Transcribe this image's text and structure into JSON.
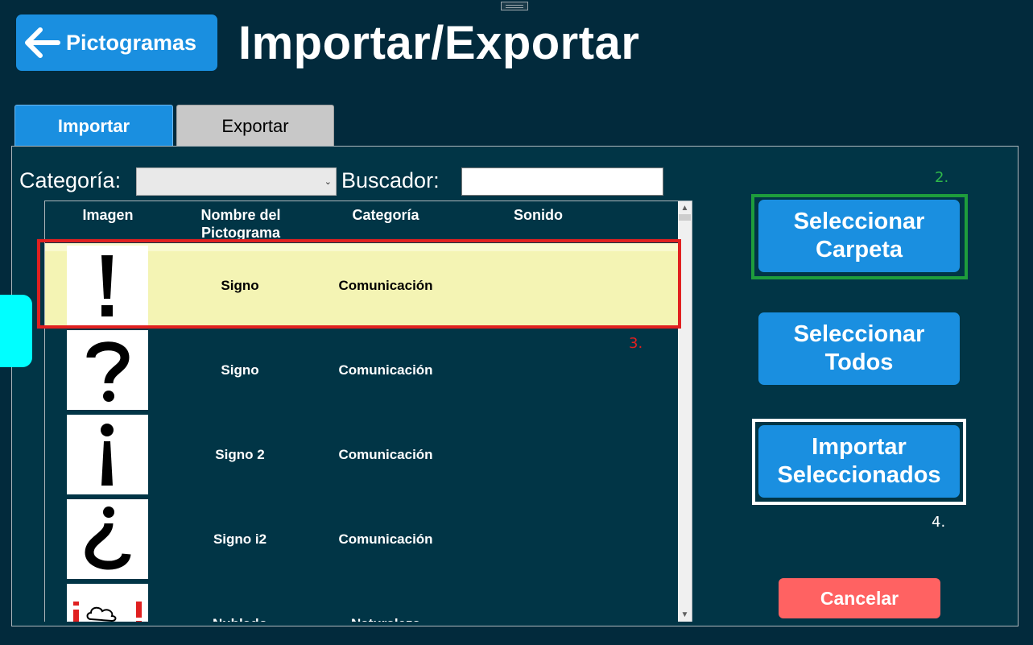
{
  "header": {
    "back_label": "Pictogramas",
    "title": "Importar/Exportar"
  },
  "tabs": [
    {
      "label": "Importar",
      "active": true
    },
    {
      "label": "Exportar",
      "active": false
    }
  ],
  "filters": {
    "category_label": "Categoría:",
    "category_value": "",
    "search_label": "Buscador:",
    "search_value": ""
  },
  "grid": {
    "columns": [
      "Imagen",
      "Nombre del Pictograma",
      "Categoría",
      "Sonido"
    ],
    "rows": [
      {
        "image": "exclamation-icon",
        "name": "Signo",
        "category": "Comunicación",
        "sound": "",
        "selected": true
      },
      {
        "image": "question-icon",
        "name": "Signo",
        "category": "Comunicación",
        "sound": "",
        "selected": false
      },
      {
        "image": "inverted-exclamation-icon",
        "name": "Signo 2",
        "category": "Comunicación",
        "sound": "",
        "selected": false
      },
      {
        "image": "inverted-question-icon",
        "name": "Signo i2",
        "category": "Comunicación",
        "sound": "",
        "selected": false
      },
      {
        "image": "cloudy-icon",
        "name": "Nublado",
        "category": "Naturaleza",
        "sound": "",
        "selected": false
      }
    ]
  },
  "actions": {
    "select_folder": "Seleccionar Carpeta",
    "select_all": "Seleccionar Todos",
    "import_selected": "Importar Seleccionados",
    "cancel": "Cancelar"
  },
  "annotations": {
    "step2": "2.",
    "step3": "3.",
    "step4": "4."
  },
  "colors": {
    "background": "#022a3c",
    "primary_button": "#1a8fe0",
    "cancel_button": "#ff6262",
    "selected_row": "#f4f4b4",
    "annotation_green": "#1e9d3c",
    "annotation_red": "#e02020"
  }
}
